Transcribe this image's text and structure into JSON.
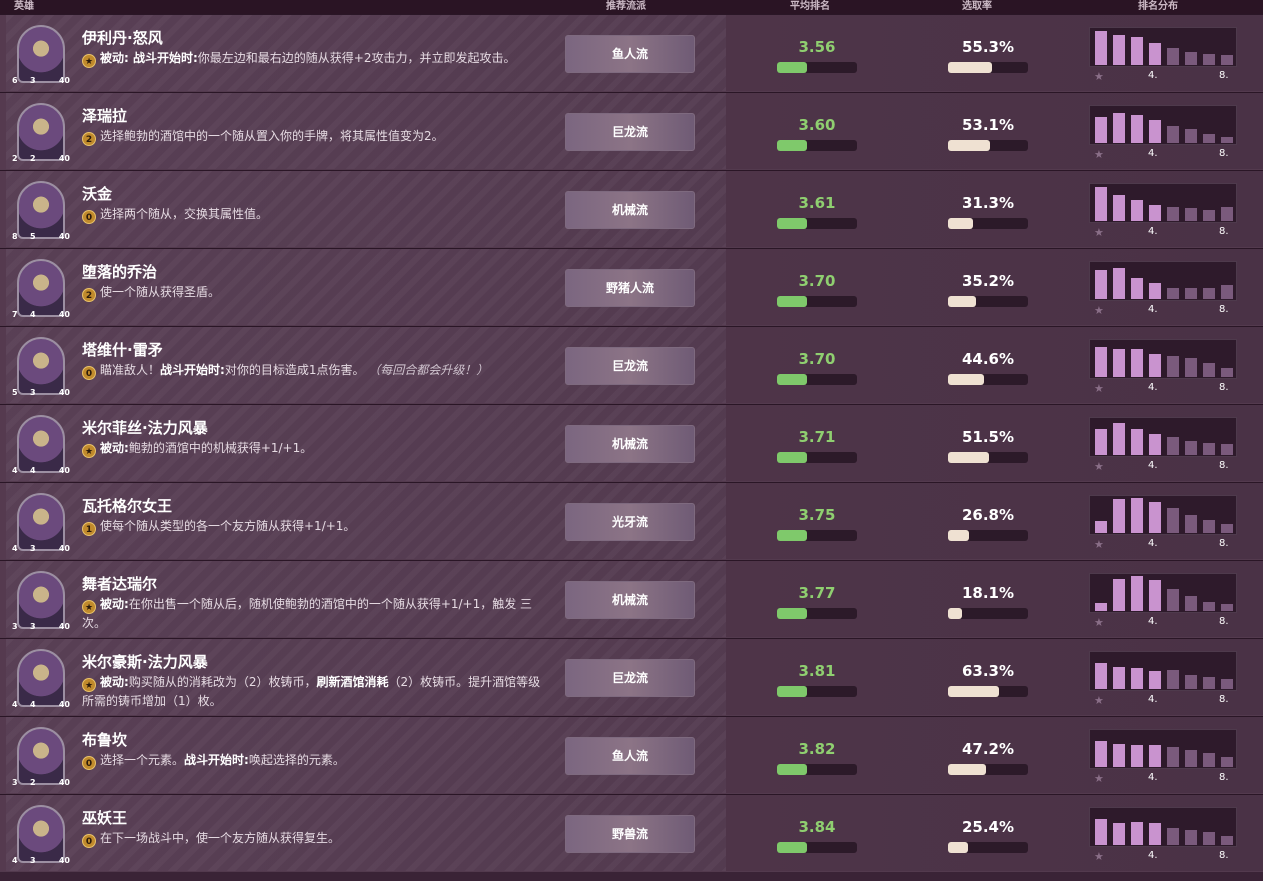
{
  "header": {
    "columns": [
      "英雄",
      "推荐流派",
      "平均排名",
      "选取率",
      "排名分布"
    ]
  },
  "dist_labels": {
    "mid": "4.",
    "end": "8."
  },
  "heroes": [
    {
      "name": "伊利丹·怒风",
      "atk": "6",
      "hp": "3",
      "armor": "40",
      "coin": "★",
      "desc_bold": "被动: 战斗开始时:",
      "desc": "你最左边和最右边的随从获得+2攻击力，并立即发起攻击。",
      "desc_italic": "",
      "tag": "鱼人流",
      "avg": "3.56",
      "avg_fill": 0.38,
      "win": "55.3%",
      "win_pct": 0.553,
      "dist": [
        0.95,
        0.82,
        0.78,
        0.62,
        0.48,
        0.35,
        0.3,
        0.28
      ]
    },
    {
      "name": "泽瑞拉",
      "atk": "2",
      "hp": "2",
      "armor": "40",
      "coin": "2",
      "desc_bold": "",
      "desc": "选择鲍勃的酒馆中的一个随从置入你的手牌，将其属性值变为2。",
      "desc_italic": "",
      "tag": "巨龙流",
      "avg": "3.60",
      "avg_fill": 0.38,
      "win": "53.1%",
      "win_pct": 0.531,
      "dist": [
        0.72,
        0.82,
        0.78,
        0.65,
        0.48,
        0.4,
        0.25,
        0.18
      ]
    },
    {
      "name": "沃金",
      "atk": "8",
      "hp": "5",
      "armor": "40",
      "coin": "0",
      "desc_bold": "",
      "desc": "选择两个随从，交换其属性值。",
      "desc_italic": "",
      "tag": "机械流",
      "avg": "3.61",
      "avg_fill": 0.38,
      "win": "31.3%",
      "win_pct": 0.313,
      "dist": [
        0.95,
        0.72,
        0.58,
        0.45,
        0.38,
        0.35,
        0.3,
        0.38
      ]
    },
    {
      "name": "堕落的乔治",
      "atk": "7",
      "hp": "4",
      "armor": "40",
      "coin": "2",
      "desc_bold": "",
      "desc": "使一个随从获得圣盾。",
      "desc_italic": "",
      "tag": "野猪人流",
      "avg": "3.70",
      "avg_fill": 0.38,
      "win": "35.2%",
      "win_pct": 0.352,
      "dist": [
        0.8,
        0.85,
        0.58,
        0.45,
        0.3,
        0.3,
        0.3,
        0.38
      ]
    },
    {
      "name": "塔维什·雷矛",
      "atk": "5",
      "hp": "3",
      "armor": "40",
      "coin": "0",
      "desc_bold": "",
      "desc": "瞄准敌人！",
      "desc_bold2": "战斗开始时:",
      "desc2": "对你的目标造成1点伤害。",
      "desc_italic": "（每回合都会升级！）",
      "tag": "巨龙流",
      "avg": "3.70",
      "avg_fill": 0.38,
      "win": "44.6%",
      "win_pct": 0.446,
      "dist": [
        0.82,
        0.78,
        0.78,
        0.65,
        0.58,
        0.52,
        0.38,
        0.25
      ]
    },
    {
      "name": "米尔菲丝·法力风暴",
      "atk": "4",
      "hp": "4",
      "armor": "40",
      "coin": "★",
      "desc_bold": "被动:",
      "desc": "鲍勃的酒馆中的机械获得+1/+1。",
      "desc_italic": "",
      "tag": "机械流",
      "avg": "3.71",
      "avg_fill": 0.38,
      "win": "51.5%",
      "win_pct": 0.515,
      "dist": [
        0.72,
        0.9,
        0.72,
        0.58,
        0.5,
        0.4,
        0.32,
        0.3
      ]
    },
    {
      "name": "瓦托格尔女王",
      "atk": "4",
      "hp": "3",
      "armor": "40",
      "coin": "1",
      "desc_bold": "",
      "desc": "使每个随从类型的各一个友方随从获得+1/+1。",
      "desc_italic": "",
      "tag": "光牙流",
      "avg": "3.75",
      "avg_fill": 0.38,
      "win": "26.8%",
      "win_pct": 0.268,
      "dist": [
        0.32,
        0.95,
        0.98,
        0.85,
        0.7,
        0.5,
        0.35,
        0.25
      ]
    },
    {
      "name": "舞者达瑞尔",
      "atk": "3",
      "hp": "3",
      "armor": "40",
      "coin": "★",
      "desc_bold": "被动:",
      "desc": "在你出售一个随从后，随机使鲍勃的酒馆中的一个随从获得+1/+1，触发 三次。",
      "desc_italic": "",
      "tag": "机械流",
      "avg": "3.77",
      "avg_fill": 0.38,
      "win": "18.1%",
      "win_pct": 0.181,
      "dist": [
        0.22,
        0.9,
        0.98,
        0.85,
        0.6,
        0.42,
        0.25,
        0.2
      ]
    },
    {
      "name": "米尔豪斯·法力风暴",
      "atk": "4",
      "hp": "4",
      "armor": "40",
      "coin": "★",
      "desc_bold": "被动:",
      "desc": "购买随从的消耗改为（2）枚铸币，",
      "desc_bold2": "刷新酒馆消耗",
      "desc2": "（2）枚铸币。提升酒馆等级所需的铸币增加（1）枚。",
      "desc_italic": "",
      "tag": "巨龙流",
      "avg": "3.81",
      "avg_fill": 0.38,
      "win": "63.3%",
      "win_pct": 0.633,
      "dist": [
        0.72,
        0.62,
        0.58,
        0.5,
        0.52,
        0.4,
        0.32,
        0.28
      ]
    },
    {
      "name": "布鲁坎",
      "atk": "3",
      "hp": "2",
      "armor": "40",
      "coin": "0",
      "desc_bold": "",
      "desc": "选择一个元素。",
      "desc_bold2": "战斗开始时:",
      "desc2": "唤起选择的元素。",
      "desc_italic": "",
      "tag": "鱼人流",
      "avg": "3.82",
      "avg_fill": 0.38,
      "win": "47.2%",
      "win_pct": 0.472,
      "dist": [
        0.72,
        0.65,
        0.62,
        0.6,
        0.55,
        0.48,
        0.4,
        0.28
      ]
    },
    {
      "name": "巫妖王",
      "atk": "4",
      "hp": "3",
      "armor": "40",
      "coin": "0",
      "desc_bold": "",
      "desc": "在下一场战斗中，使一个友方随从获得复生。",
      "desc_italic": "",
      "tag": "野兽流",
      "avg": "3.84",
      "avg_fill": 0.38,
      "win": "25.4%",
      "win_pct": 0.254,
      "dist": [
        0.72,
        0.62,
        0.65,
        0.6,
        0.48,
        0.42,
        0.35,
        0.25
      ]
    }
  ]
}
